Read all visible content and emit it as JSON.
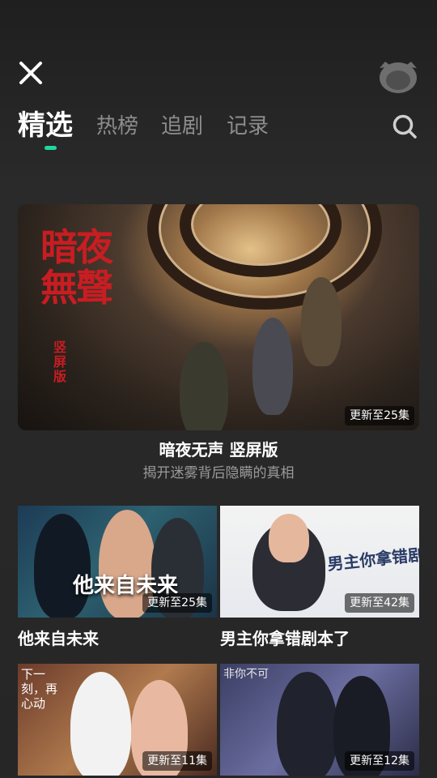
{
  "header": {
    "close_icon": "close-icon",
    "avatar_icon": "avatar-icon",
    "search_icon": "search-icon"
  },
  "tabs": [
    {
      "label": "精选",
      "active": true
    },
    {
      "label": "热榜",
      "active": false
    },
    {
      "label": "追剧",
      "active": false
    },
    {
      "label": "记录",
      "active": false
    }
  ],
  "accent_color": "#1ed8a0",
  "hero": {
    "poster_title": "暗夜無聲",
    "poster_sub": "竖屏版",
    "badge": "更新至25集",
    "title": "暗夜无声 竖屏版",
    "subtitle": "揭开迷雾背后隐瞒的真相"
  },
  "cards": [
    {
      "title": "他来自未来",
      "badge": "更新至25集",
      "overlay": "他来自未来"
    },
    {
      "title": "男主你拿错剧本了",
      "badge": "更新至42集",
      "overlay": "男主你拿错剧本了"
    },
    {
      "title": "",
      "badge": "更新至11集",
      "overlay": "下一刻，再心动"
    },
    {
      "title": "",
      "badge": "更新至12集",
      "overlay": "非你不可"
    }
  ]
}
